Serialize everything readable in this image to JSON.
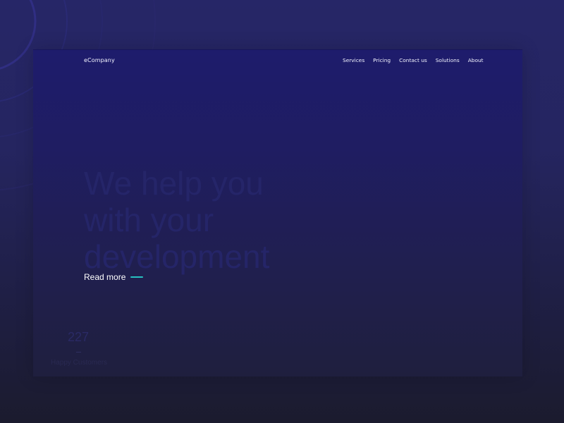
{
  "header": {
    "logo": "eCompany",
    "nav": [
      "Services",
      "Pricing",
      "Contact us",
      "Solutions",
      "About"
    ]
  },
  "hero": {
    "title_lines": [
      "We help you",
      "with your",
      "development"
    ],
    "cta_label": "Read more"
  },
  "stats": {
    "number": "227",
    "label": "Happy Customers"
  },
  "colors": {
    "background_top": "#262667",
    "background_bottom": "#1b1b2e",
    "frame_top": "#1e1c6c",
    "frame_bottom": "#1f1f3e",
    "accent": "#27c1c0",
    "text": "#f3f4ff"
  }
}
